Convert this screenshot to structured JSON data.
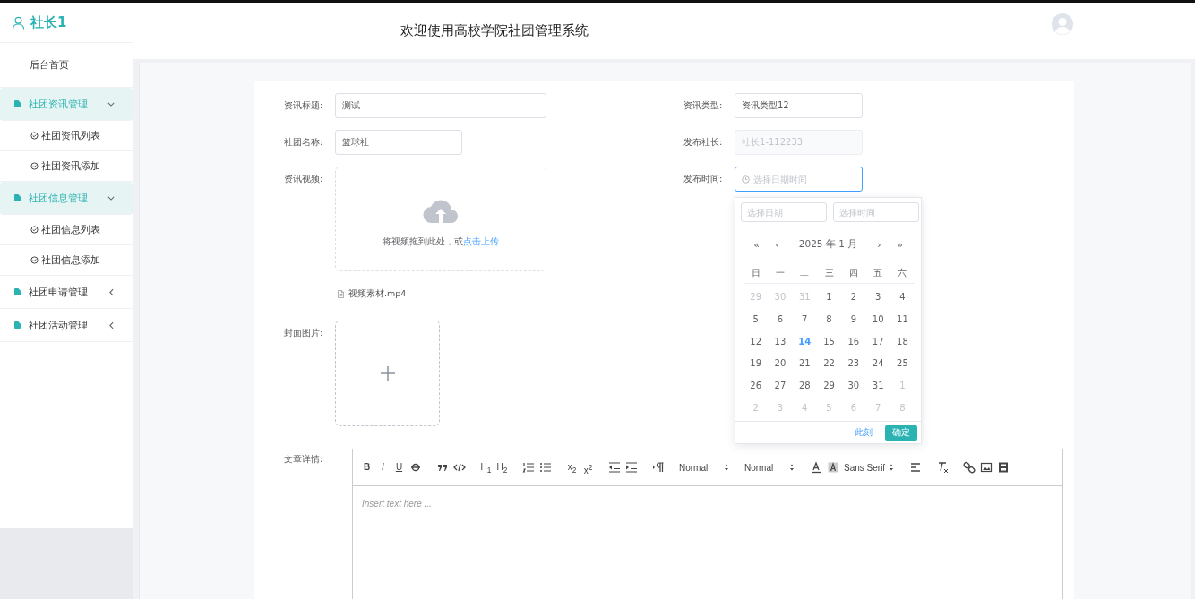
{
  "user": {
    "name": "社长1"
  },
  "header": {
    "title": "欢迎使用高校学院社团管理系统"
  },
  "sidebar": {
    "items": [
      {
        "kind": "link",
        "label": "后台首页"
      },
      {
        "kind": "group",
        "label": "社团资讯管理",
        "expanded": true,
        "children": [
          {
            "label": "社团资讯列表"
          },
          {
            "label": "社团资讯添加"
          }
        ]
      },
      {
        "kind": "group",
        "label": "社团信息管理",
        "expanded": true,
        "children": [
          {
            "label": "社团信息列表"
          },
          {
            "label": "社团信息添加"
          }
        ]
      },
      {
        "kind": "group",
        "label": "社团申请管理",
        "expanded": false
      },
      {
        "kind": "group",
        "label": "社团活动管理",
        "expanded": false
      }
    ]
  },
  "form": {
    "title": {
      "label": "资讯标题:",
      "value": "测试"
    },
    "club": {
      "label": "社团名称:",
      "value": "篮球社"
    },
    "video": {
      "label": "资讯视频:",
      "hint": "将视频拖到此处，或",
      "link": "点击上传",
      "file": "视频素材.mp4"
    },
    "cover": {
      "label": "封面图片:"
    },
    "type": {
      "label": "资讯类型:",
      "value": "资讯类型12"
    },
    "leader": {
      "label": "发布社长:",
      "value": "社长1-112233",
      "disabled": true
    },
    "time": {
      "label": "发布时间:",
      "placeholder": "选择日期时间",
      "focused": true
    },
    "content": {
      "label": "文章详情:",
      "placeholder": "Insert text here ..."
    }
  },
  "date_picker": {
    "date_placeholder": "选择日期",
    "time_placeholder": "选择时间",
    "prev_year": "«",
    "prev_month": "‹",
    "header": "2025 年  1 月",
    "next_month": "›",
    "next_year": "»",
    "weekdays": [
      "日",
      "一",
      "二",
      "三",
      "四",
      "五",
      "六"
    ],
    "weeks": [
      [
        {
          "day": "29",
          "kind": "other"
        },
        {
          "day": "30",
          "kind": "other"
        },
        {
          "day": "31",
          "kind": "other"
        },
        {
          "day": "1",
          "kind": "current"
        },
        {
          "day": "2",
          "kind": "current"
        },
        {
          "day": "3",
          "kind": "current"
        },
        {
          "day": "4",
          "kind": "current"
        }
      ],
      [
        {
          "day": "5",
          "kind": "current"
        },
        {
          "day": "6",
          "kind": "current"
        },
        {
          "day": "7",
          "kind": "current"
        },
        {
          "day": "8",
          "kind": "current"
        },
        {
          "day": "9",
          "kind": "current"
        },
        {
          "day": "10",
          "kind": "current"
        },
        {
          "day": "11",
          "kind": "current"
        }
      ],
      [
        {
          "day": "12",
          "kind": "current"
        },
        {
          "day": "13",
          "kind": "current"
        },
        {
          "day": "14",
          "kind": "today"
        },
        {
          "day": "15",
          "kind": "current"
        },
        {
          "day": "16",
          "kind": "current"
        },
        {
          "day": "17",
          "kind": "current"
        },
        {
          "day": "18",
          "kind": "current"
        }
      ],
      [
        {
          "day": "19",
          "kind": "current"
        },
        {
          "day": "20",
          "kind": "current"
        },
        {
          "day": "21",
          "kind": "current"
        },
        {
          "day": "22",
          "kind": "current"
        },
        {
          "day": "23",
          "kind": "current"
        },
        {
          "day": "24",
          "kind": "current"
        },
        {
          "day": "25",
          "kind": "current"
        }
      ],
      [
        {
          "day": "26",
          "kind": "current"
        },
        {
          "day": "27",
          "kind": "current"
        },
        {
          "day": "28",
          "kind": "current"
        },
        {
          "day": "29",
          "kind": "current"
        },
        {
          "day": "30",
          "kind": "current"
        },
        {
          "day": "31",
          "kind": "current"
        },
        {
          "day": "1",
          "kind": "other"
        }
      ],
      [
        {
          "day": "2",
          "kind": "other"
        },
        {
          "day": "3",
          "kind": "other"
        },
        {
          "day": "4",
          "kind": "other"
        },
        {
          "day": "5",
          "kind": "other"
        },
        {
          "day": "6",
          "kind": "other"
        },
        {
          "day": "7",
          "kind": "other"
        },
        {
          "day": "8",
          "kind": "other"
        }
      ]
    ],
    "now_button": "此刻",
    "ok_button": "确定"
  },
  "toolbar": [
    {
      "kind": "bold",
      "label": "B"
    },
    {
      "kind": "italic",
      "label": "I"
    },
    {
      "kind": "underline",
      "label": "U"
    },
    {
      "kind": "strike"
    },
    {
      "kind": "sep"
    },
    {
      "kind": "quote"
    },
    {
      "kind": "code"
    },
    {
      "kind": "sep"
    },
    {
      "kind": "text",
      "label": "H$_{1}$"
    },
    {
      "kind": "text",
      "label": "H$_{2}$"
    },
    {
      "kind": "sep"
    },
    {
      "kind": "ordered"
    },
    {
      "kind": "bullet"
    },
    {
      "kind": "sep"
    },
    {
      "kind": "text",
      "label": "x$_{2}$"
    },
    {
      "kind": "text",
      "label": "x$^{2}$"
    },
    {
      "kind": "sep"
    },
    {
      "kind": "outdent"
    },
    {
      "kind": "indent"
    },
    {
      "kind": "sep"
    },
    {
      "kind": "rtl"
    },
    {
      "kind": "sep"
    },
    {
      "kind": "picker",
      "label": "Normal"
    },
    {
      "kind": "picker",
      "label": "Normal"
    },
    {
      "kind": "color"
    },
    {
      "kind": "background"
    },
    {
      "kind": "picker",
      "label": "Sans Serif"
    },
    {
      "kind": "align"
    },
    {
      "kind": "sep"
    },
    {
      "kind": "clean"
    },
    {
      "kind": "sep"
    },
    {
      "kind": "link"
    },
    {
      "kind": "image"
    },
    {
      "kind": "video"
    }
  ]
}
